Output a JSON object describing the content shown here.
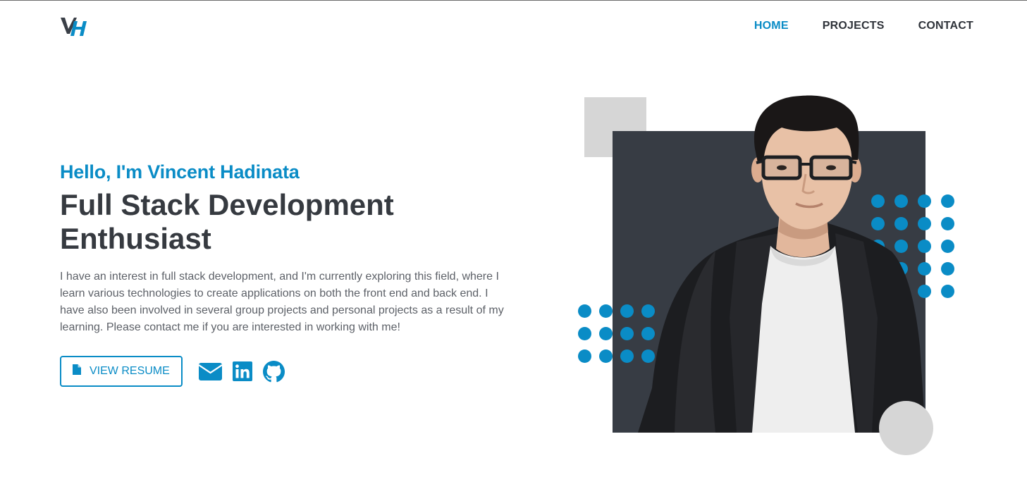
{
  "header": {
    "logo_text": "VH",
    "nav": [
      {
        "label": "HOME",
        "active": true
      },
      {
        "label": "PROJECTS",
        "active": false
      },
      {
        "label": "CONTACT",
        "active": false
      }
    ]
  },
  "hero": {
    "greeting": "Hello, I'm Vincent Hadinata",
    "headline": "Full Stack Development Enthusiast",
    "bio": "I have an interest in full stack development, and I'm currently exploring this field, where I learn various technologies to create applications on both the front end and back end. I have also been involved in several group projects and personal projects as a result of my learning. Please contact me if you are interested in working with me!",
    "resume_label": "VIEW RESUME",
    "socials": [
      {
        "icon": "envelope-icon"
      },
      {
        "icon": "linkedin-icon"
      },
      {
        "icon": "github-icon"
      }
    ]
  },
  "colors": {
    "accent": "#0a8cc6",
    "dark": "#373c44",
    "text": "#363a40",
    "muted": "#5d6168",
    "gray_shape": "#d6d6d6"
  }
}
